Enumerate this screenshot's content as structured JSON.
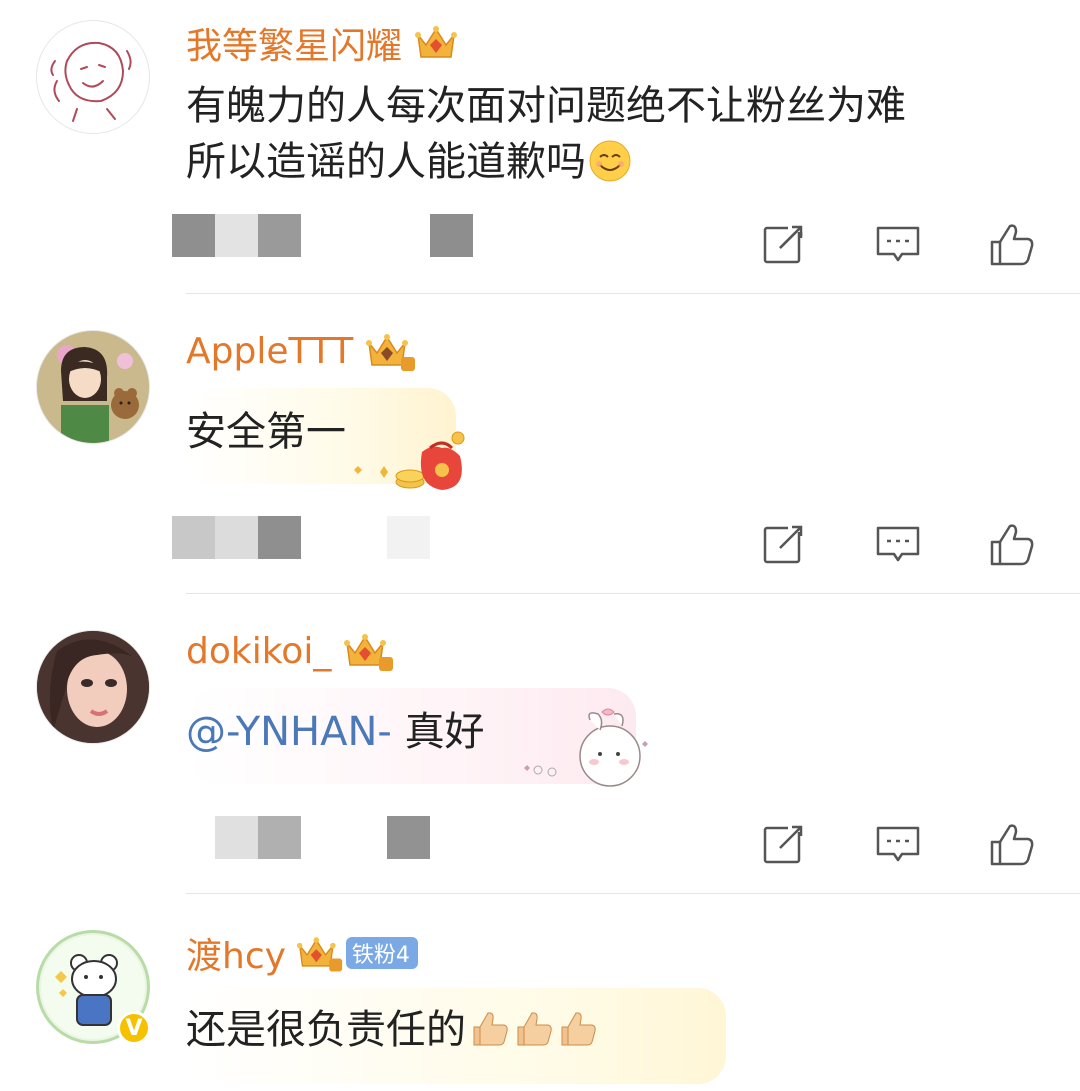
{
  "comments": [
    {
      "username": "我等繁星闪耀",
      "text_line1": "有魄力的人每次面对问题绝不让粉丝为难",
      "text_line2": "所以造谣的人能道歉吗",
      "emoji": "smiling-face-emoji"
    },
    {
      "username": "AppleTTT",
      "crown_level": "6",
      "text": "安全第一",
      "bubble_decoration": "lucky-bag-coins"
    },
    {
      "username": "dokikoi_",
      "crown_level": "6",
      "mention": "@-YNHAN-",
      "text": "真好",
      "bubble_decoration": "bunny-sticker"
    },
    {
      "username": "渡hcy",
      "crown_level": "6",
      "fan_badge": "铁粉4",
      "text": "还是很负责任的",
      "emoji": "thumbs-up-emoji",
      "emoji_count": 3,
      "verified_badge": "V"
    }
  ],
  "actions": [
    "share-icon",
    "comment-icon",
    "like-icon"
  ],
  "colors": {
    "username": "#e3782a",
    "mention": "#4a78b8",
    "text": "#222222",
    "icon": "#555555",
    "divider": "#e5e5e5",
    "fan_badge": "#7aa9e6"
  }
}
